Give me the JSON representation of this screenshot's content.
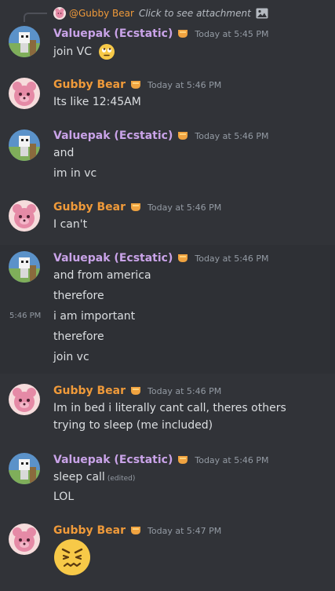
{
  "users": {
    "valuepak": "Valuepak (Ecstatic)",
    "gubby": "Gubby Bear"
  },
  "reply": {
    "mention": "@Gubby Bear",
    "text": "Click to see attachment"
  },
  "messages": [
    {
      "author": "valuepak",
      "timestamp": "Today at 5:45 PM",
      "lines": [
        "join VC"
      ]
    },
    {
      "author": "gubby",
      "timestamp": "Today at 5:46 PM",
      "lines": [
        "Its like 12:45AM"
      ]
    },
    {
      "author": "valuepak",
      "timestamp": "Today at 5:46 PM",
      "lines": [
        "and",
        "im in vc"
      ]
    },
    {
      "author": "gubby",
      "timestamp": "Today at 5:46 PM",
      "lines": [
        "I can't"
      ]
    },
    {
      "author": "valuepak",
      "timestamp": "Today at 5:46 PM",
      "lines": [
        "and from america",
        "therefore",
        "i am important",
        "therefore",
        "join vc"
      ],
      "hover_time": "5:46 PM"
    },
    {
      "author": "gubby",
      "timestamp": "Today at 5:46 PM",
      "lines": [
        "Im in bed i literally cant call, theres others",
        "trying to sleep (me included)"
      ]
    },
    {
      "author": "valuepak",
      "timestamp": "Today at 5:46 PM",
      "lines": [
        "sleep call",
        "LOL"
      ],
      "edited": "(edited)"
    },
    {
      "author": "gubby",
      "timestamp": "Today at 5:47 PM",
      "lines": []
    }
  ],
  "colors": {
    "background": "#313338",
    "valuepak_name": "#c9a3e8",
    "gubby_name": "#ef9a3a",
    "timestamp": "#949ba4",
    "text": "#dbdee1"
  },
  "icons": {
    "reply_attachment": "image-icon",
    "role_badge": "orange-badge-icon",
    "emoji_1": "rolling-eyes-emoji",
    "emoji_2": "confounded-emoji"
  }
}
